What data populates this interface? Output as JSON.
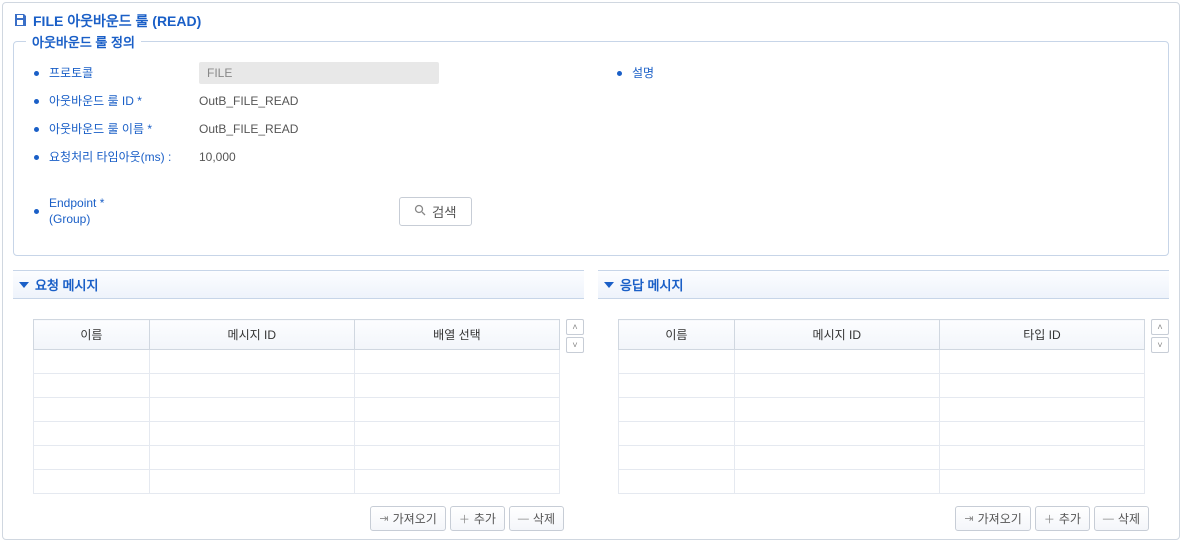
{
  "pageTitle": "FILE 아웃바운드 룰 (READ)",
  "fieldset": {
    "legend": "아웃바운드 룰 정의",
    "fields": {
      "protocol": {
        "label": "프로토콜",
        "value": "FILE"
      },
      "ruleId": {
        "label": "아웃바운드 룰 ID *",
        "value": "OutB_FILE_READ"
      },
      "ruleName": {
        "label": "아웃바운드 룰 이름 *",
        "value": "OutB_FILE_READ"
      },
      "timeout": {
        "label": "요청처리 타임아웃(ms) :",
        "value": "10,000"
      },
      "endpoint": {
        "label": "Endpoint *\n(Group)",
        "searchLabel": "검색"
      },
      "description": {
        "label": "설명"
      }
    }
  },
  "requestPanel": {
    "title": "요청 메시지",
    "columns": [
      "이름",
      "메시지 ID",
      "배열 선택"
    ],
    "buttons": {
      "import": "가져오기",
      "add": "추가",
      "delete": "삭제"
    }
  },
  "responsePanel": {
    "title": "응답 메시지",
    "columns": [
      "이름",
      "메시지 ID",
      "타입 ID"
    ],
    "buttons": {
      "import": "가져오기",
      "add": "추가",
      "delete": "삭제"
    }
  }
}
